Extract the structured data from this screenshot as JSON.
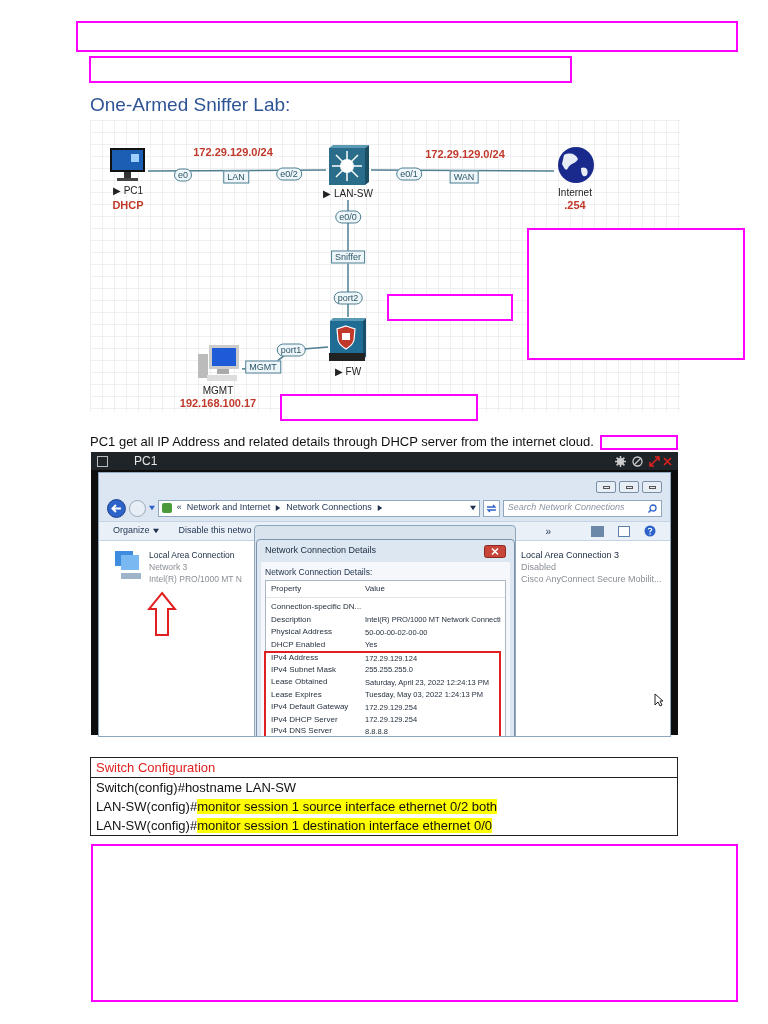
{
  "heading": "One-Armed Sniffer Lab:",
  "diagram": {
    "nodes": [
      {
        "kind": "pc",
        "label": "▶ PC1",
        "note": "DHCP"
      },
      {
        "kind": "switch",
        "label": "▶ LAN-SW"
      },
      {
        "kind": "globe",
        "label": "Internet",
        "note": ".254"
      },
      {
        "kind": "firewall",
        "label": "▶ FW"
      },
      {
        "kind": "workstation",
        "label": "MGMT",
        "note": "192.168.100.17"
      }
    ],
    "subnets": [
      "172.29.129.0/24",
      "172.29.129.0/24"
    ],
    "link_tags": [
      "e0",
      "LAN",
      "e0/2",
      "e0/1",
      "WAN",
      "e0/0",
      "Sniffer",
      "port2",
      "port1",
      "MGMT"
    ]
  },
  "intro": "PC1 get all IP Address and related details through DHCP server from the internet cloud.",
  "vm_window": {
    "title": "PC1",
    "explorer": {
      "breadcrumb": [
        "«",
        "Network and Internet",
        "Network Connections"
      ],
      "search_placeholder": "Search Network Connections",
      "toolbar": [
        "Organize",
        "Disable this netwo"
      ],
      "more": "»",
      "connections": [
        {
          "name": "Local Area Connection",
          "status": "Network  3",
          "device": "Intel(R) PRO/1000 MT N"
        },
        {
          "name": "Local Area Connection 3",
          "status": "Disabled",
          "device": "Cisco AnyConnect Secure Mobilit..."
        }
      ]
    },
    "dialog": {
      "title": "Network Connection Details",
      "subtitle": "Network Connection Details:",
      "columns": [
        "Property",
        "Value"
      ],
      "rows": [
        {
          "property": "Connection-specific DN...",
          "highlighted": false
        },
        {
          "property": "Description",
          "value": "Intel(R) PRO/1000 MT Network Connecti",
          "highlighted": false
        },
        {
          "property": "Physical Address",
          "value": "50-00-00-02-00-00",
          "highlighted": false
        },
        {
          "property": "DHCP Enabled",
          "value": "Yes",
          "highlighted": false
        },
        {
          "property": "IPv4 Address",
          "value": "172.29.129.124",
          "highlighted": true
        },
        {
          "property": "IPv4 Subnet Mask",
          "value": "255.255.255.0",
          "highlighted": true
        },
        {
          "property": "Lease Obtained",
          "value": "Saturday, April 23, 2022 12:24:13 PM",
          "highlighted": true
        },
        {
          "property": "Lease Expires",
          "value": "Tuesday, May 03, 2022 1:24:13 PM",
          "highlighted": true
        },
        {
          "property": "IPv4 Default Gateway",
          "value": "172.29.129.254",
          "highlighted": true
        },
        {
          "property": "IPv4 DHCP Server",
          "value": "172.29.129.254",
          "highlighted": true
        },
        {
          "property": "IPv4 DNS Server",
          "value": "8.8.8.8",
          "highlighted": true
        }
      ]
    }
  },
  "config_table": {
    "header": "Switch Configuration",
    "lines": [
      {
        "prompt": "Switch(config)#",
        "command": "hostname LAN-SW",
        "highlighted": false
      },
      {
        "prompt": "LAN-SW(config)#",
        "command": "monitor session 1 source interface ethernet 0/2 both",
        "highlighted": true
      },
      {
        "prompt": "LAN-SW(config)#",
        "command": "monitor session 1 destination interface ethernet 0/0",
        "highlighted": true
      }
    ]
  }
}
